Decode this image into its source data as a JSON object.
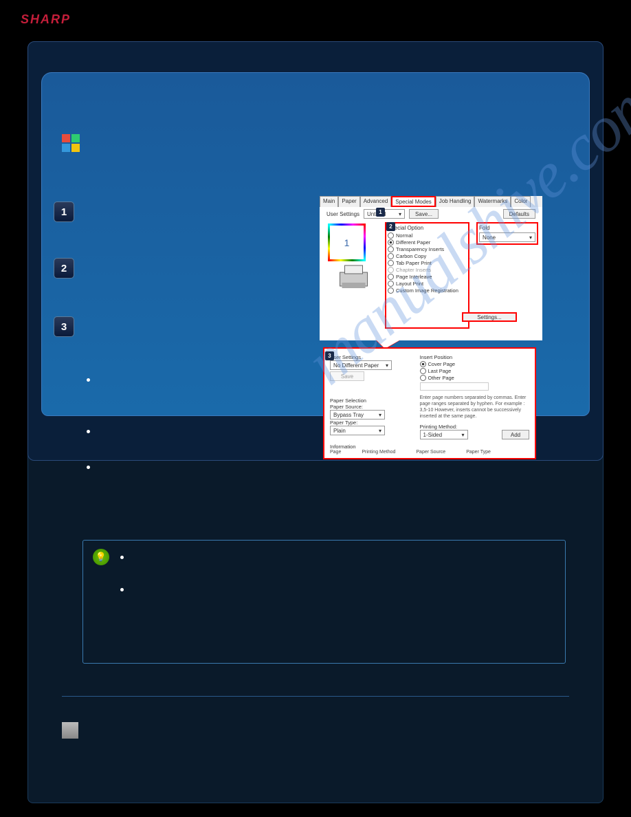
{
  "brand": "SHARP",
  "watermark": "manualshive.com",
  "dialog1": {
    "tabs": [
      "Main",
      "Paper",
      "Advanced",
      "Special Modes",
      "Job Handling",
      "Watermarks",
      "Color"
    ],
    "selected_tab": "Special Modes",
    "user_settings_label": "User Settings",
    "user_settings_value": "Untitled",
    "save_btn": "Save...",
    "defaults_btn": "Defaults",
    "special_option_label": "Special Option",
    "options": [
      {
        "label": "Normal",
        "selected": false
      },
      {
        "label": "Different Paper",
        "selected": true
      },
      {
        "label": "Transparency Inserts",
        "selected": false
      },
      {
        "label": "Carbon Copy",
        "selected": false
      },
      {
        "label": "Tab Paper Print",
        "selected": false
      },
      {
        "label": "Chapter Inserts",
        "selected": false
      },
      {
        "label": "Page Interleave",
        "selected": false
      },
      {
        "label": "Layout Print",
        "selected": false
      },
      {
        "label": "Custom Image Registration",
        "selected": false
      }
    ],
    "fold_label": "Fold",
    "fold_value": "None",
    "settings_btn": "Settings...",
    "preview_num": "1"
  },
  "dialog2": {
    "user_settings_label": "User Settings",
    "user_settings_value": "No Different Paper",
    "save_btn": "Save",
    "insert_position_label": "Insert Position",
    "insert_options": [
      {
        "label": "Cover Page",
        "selected": true
      },
      {
        "label": "Last Page",
        "selected": false
      },
      {
        "label": "Other Page",
        "selected": false
      }
    ],
    "paper_selection_label": "Paper Selection",
    "paper_source_label": "Paper Source:",
    "paper_source_value": "Bypass Tray",
    "paper_type_label": "Paper Type:",
    "paper_type_value": "Plain",
    "printing_method_label": "Printing Method:",
    "printing_method_value": "1-Sided",
    "add_btn": "Add",
    "hint": "Enter page numbers separated by commas.\nEnter page ranges separated by hyphen.\nFor example : 3,5-10\nHowever, inserts cannot be successively inserted at the same page.",
    "info_label": "Information",
    "cols": [
      "Page",
      "Printing Method",
      "Paper Source",
      "Paper Type"
    ]
  },
  "steps": {
    "s1": "1",
    "s2": "2",
    "s3": "3"
  }
}
